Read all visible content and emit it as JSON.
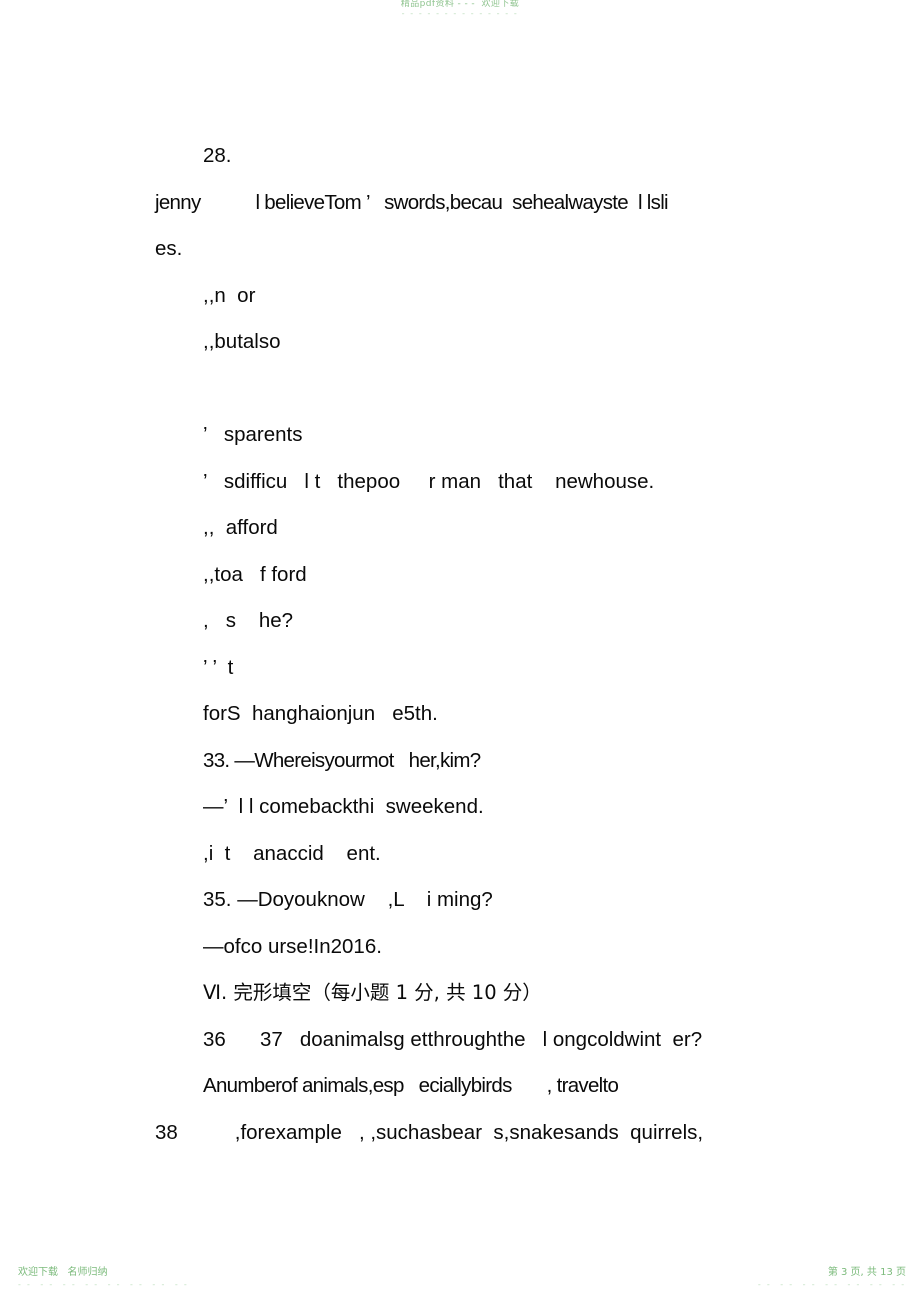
{
  "document": {
    "watermark_header": {
      "line1": "精品pdf资料 - - -  欢迎下载",
      "line2": "- - - - - - - - - - - - - -"
    },
    "watermark_footer_left": {
      "line1": "欢迎下载   名师归纳",
      "line2": "- -  - -  - -  - -  - -  - -  - -  - -"
    },
    "watermark_footer_right": {
      "line1": "第 3 页, 共 13 页",
      "line2": "- -  - -  - -  - -  - -  - -  - -"
    },
    "lines": [
      {
        "id": "q28-number",
        "text": "28."
      },
      {
        "id": "q28-stem",
        "text": "jenny           l believeTom ’   swords,becau  sehealwayste  l lsli"
      },
      {
        "id": "q28-stem-wrap",
        "text": "es."
      },
      {
        "id": "q28-option-a",
        "text": ",,n  or"
      },
      {
        "id": "q28-option-b",
        "text": ",,butalso"
      },
      {
        "id": "spacer-1",
        "text": ""
      },
      {
        "id": "q30-stem",
        "text": "’   sparents"
      },
      {
        "id": "q31-stem",
        "text": "’   sdifficu   l t   thepoo     r man   that    newhouse."
      },
      {
        "id": "q31-option-a",
        "text": ",,  afford"
      },
      {
        "id": "q31-option-b",
        "text": ",,toa   f ford"
      },
      {
        "id": "q32-stem",
        "text": ",   s    he?"
      },
      {
        "id": "q32-option",
        "text": "’ ’  t"
      },
      {
        "id": "q32-tail",
        "text": "forS  hanghaionjun   e5th."
      },
      {
        "id": "q33-stem",
        "text": "33. —Whereisyourmot   her,kim?"
      },
      {
        "id": "q33-answer",
        "text": "—’  l l comebackthi  sweekend."
      },
      {
        "id": "q34-tail",
        "text": ",i  t    anaccid    ent."
      },
      {
        "id": "q35-stem",
        "text": "35. —Doyouknow    ,L    i ming?"
      },
      {
        "id": "q35-answer",
        "text": "—ofco urse!In2016."
      },
      {
        "id": "section-heading",
        "text": "Ⅵ. 完形填空（每小题 1 分, 共 10 分）"
      },
      {
        "id": "cloze-line-1",
        "text": "36      37   doanimalsg etthroughthe   l ongcoldwint  er?"
      },
      {
        "id": "cloze-line-2",
        "text": "Anumberof animals,esp   eciallybirds       , travelto"
      },
      {
        "id": "cloze-line-3",
        "text": "38          ,forexample   , ,suchasbear  s,snakesands  quirrels,"
      }
    ]
  }
}
